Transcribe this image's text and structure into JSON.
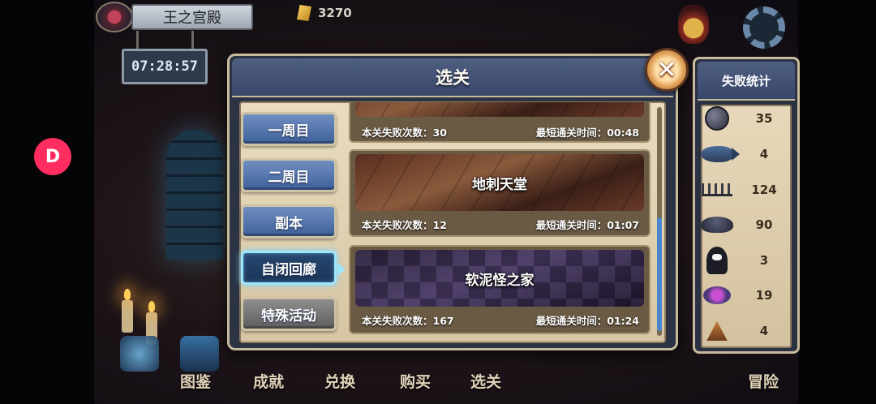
{
  "hud": {
    "location": "王之宫殿",
    "timer": "07:28:57",
    "gold": "3270"
  },
  "dialog": {
    "title": "选关",
    "close_label": "✕"
  },
  "tabs": [
    {
      "label": "一周目",
      "active": false
    },
    {
      "label": "二周目",
      "active": false
    },
    {
      "label": "副本",
      "active": false
    },
    {
      "label": "自闭回廊",
      "active": true
    },
    {
      "label": "特殊活动",
      "active": false
    }
  ],
  "levels": [
    {
      "name": "",
      "fail_count": "本关失败次数：30",
      "best_time": "最短通关时间：00:48"
    },
    {
      "name": "地刺天堂",
      "fail_count": "本关失败次数：12",
      "best_time": "最短通关时间：01:07"
    },
    {
      "name": "软泥怪之家",
      "fail_count": "本关失败次数：167",
      "best_time": "最短通关时间：01:24"
    }
  ],
  "stats": {
    "title": "失败统计",
    "rows": [
      {
        "icon": "boulder-icon",
        "value": "35"
      },
      {
        "icon": "fish-icon",
        "value": "4"
      },
      {
        "icon": "spikes-icon",
        "value": "124"
      },
      {
        "icon": "slime-icon",
        "value": "90"
      },
      {
        "icon": "ghost-icon",
        "value": "3"
      },
      {
        "icon": "spider-icon",
        "value": "19"
      },
      {
        "icon": "fire-trap-icon",
        "value": "4"
      }
    ]
  },
  "bottom_nav": [
    {
      "label": "图鉴"
    },
    {
      "label": "成就"
    },
    {
      "label": "兑换"
    },
    {
      "label": "购买"
    },
    {
      "label": "选关"
    },
    {
      "label": "冒险"
    }
  ],
  "colors": {
    "tab_active_glow": "#9fe7ff",
    "tab_blue": "#4f6fa8",
    "tab_gray": "#777777",
    "panel_frame": "#c8bb9c",
    "scroll_thumb": "#4a86d0"
  }
}
